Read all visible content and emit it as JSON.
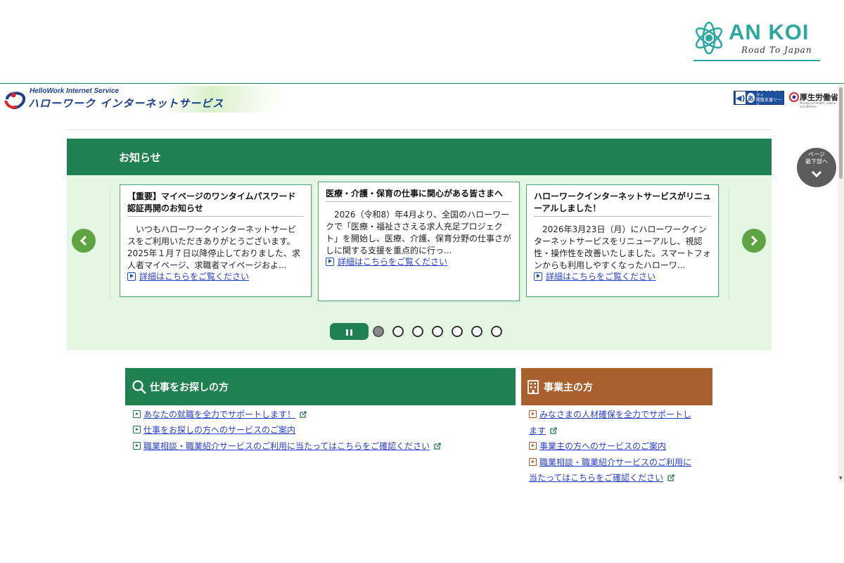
{
  "watermark": {
    "brand": "AN KOI",
    "tagline": "Road To Japan",
    "accent_color": "#2aa7a0"
  },
  "header": {
    "logo_en": "HelloWork Internet Service",
    "logo_ja": "ハローワーク インターネットサービス",
    "accessibility_icon": "accessibility-icon",
    "accessibility_label_1": "アクセシビリティ",
    "accessibility_label_2": "閲覧支援ツール",
    "ministry_name": "厚生労働省",
    "ministry_sub": "Ministry of Health, Labour and Welfare"
  },
  "notice": {
    "title": "お知らせ",
    "cards": [
      {
        "title": "【重要】マイページのワンタイムパスワード認証再開のお知らせ",
        "body": "いつもハローワークインターネットサービスをご利用いただきありがとうございます。2025年１月７日以降停止しておりました、求人者マイページ、求職者マイページおよ...",
        "more": "詳細はこちらをご覧ください"
      },
      {
        "title": "医療・介護・保育の仕事に関心がある皆さまへ",
        "body": "2026（令和8）年4月より、全国のハローワークで「医療・福祉ささえる求人充足プロジェクト」を開始し、医療、介護、保育分野の仕事さがしに関する支援を重点的に行っ...",
        "more": "詳細はこちらをご覧ください"
      },
      {
        "title": "ハローワークインターネットサービスがリニューアルしました！",
        "body": "2026年3月23日（月）にハローワークインターネットサービスをリニューアルし、視認性・操作性を改善いたしました。スマートフォンからも利用しやすくなったハローワ...",
        "more": "詳細はこちらをご覧ください"
      }
    ],
    "prev_icon": "chevron-left-icon",
    "next_icon": "chevron-right-icon",
    "pause_icon": "pause-icon",
    "dot_count": 7,
    "active_dot": 1
  },
  "jobseeker": {
    "title": "仕事をお探しの方",
    "icon": "search-icon",
    "color": "#1f8050",
    "links": [
      "あなたの就職を全力でサポートします！",
      "仕事をお探しの方へのサービスのご案内",
      "職業相談・職業紹介サービスのご利用に当たってはこちらをご確認ください"
    ]
  },
  "employer": {
    "title": "事業主の方",
    "icon": "building-icon",
    "color": "#a9602c",
    "links": [
      {
        "line1": "みなさまの人材確保を全力でサポートし",
        "line2": "ます"
      },
      {
        "line1": "事業主の方へのサービスのご案内"
      },
      {
        "line1": "職業相談・職業紹介サービスのご利用に",
        "line2": "当たってはこちらをご確認ください"
      }
    ]
  },
  "page_bottom_button": {
    "line1": "ページ",
    "line2": "最下部へ"
  }
}
